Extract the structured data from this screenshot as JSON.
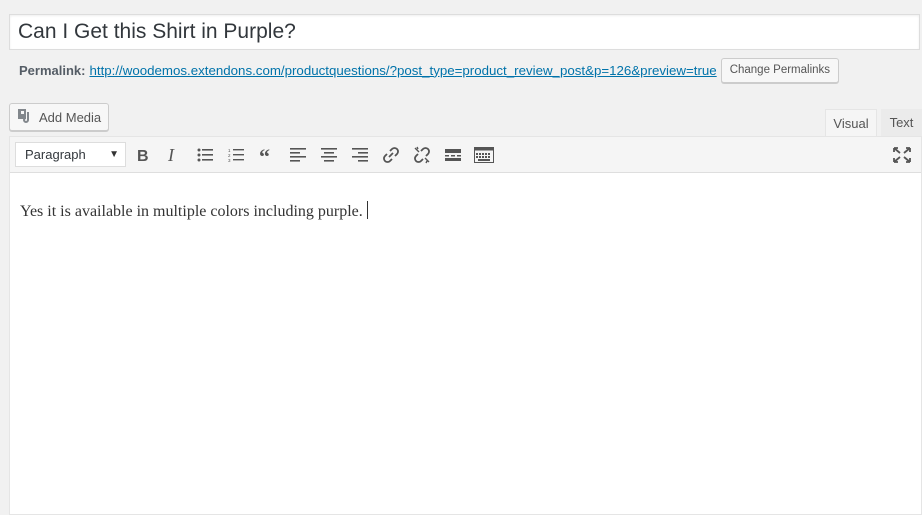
{
  "post": {
    "title": "Can I Get this Shirt in Purple?",
    "permalink_label": "Permalink:",
    "permalink_url": "http://woodemos.extendons.com/productquestions/?post_type=product_review_post&p=126&preview=true",
    "change_permalinks_label": "Change Permalinks"
  },
  "media": {
    "add_media_label": "Add Media"
  },
  "tabs": [
    {
      "label": "Visual",
      "active": true
    },
    {
      "label": "Text",
      "active": false
    }
  ],
  "toolbar": {
    "format_value": "Paragraph",
    "buttons": [
      "bold-icon",
      "italic-icon",
      "bulleted-list-icon",
      "numbered-list-icon",
      "blockquote-icon",
      "align-left-icon",
      "align-center-icon",
      "align-right-icon",
      "link-icon",
      "unlink-icon",
      "read-more-icon",
      "toolbar-toggle-icon",
      "fullscreen-icon"
    ]
  },
  "editor": {
    "content": "Yes it is available in multiple colors including purple."
  }
}
